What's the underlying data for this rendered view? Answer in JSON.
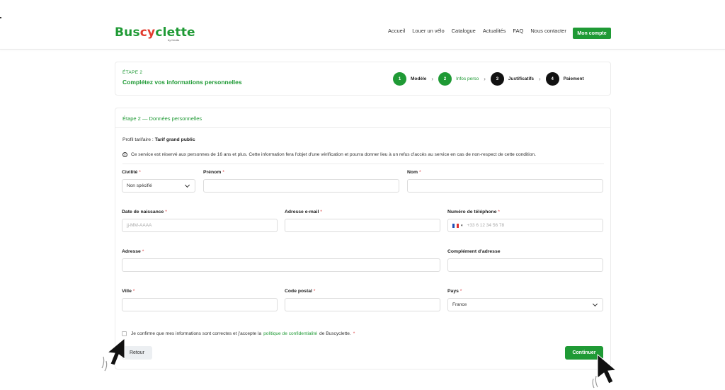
{
  "header": {
    "logo_part1": "Bus",
    "logo_part2": "cy",
    "logo_part3": "clette",
    "logo_sub": "by Keolis",
    "nav": [
      "Accueil",
      "Louer un vélo",
      "Catalogue",
      "Actualités",
      "FAQ",
      "Nous contacter"
    ],
    "account_button": "Mon compte"
  },
  "step_card": {
    "step_label": "ÉTAPE 2",
    "title": "Complétez vos informations personnelles",
    "steps": [
      {
        "num": "1",
        "name": "Modèle",
        "state": "done"
      },
      {
        "num": "2",
        "name": "Infos perso",
        "state": "current"
      },
      {
        "num": "3",
        "name": "Justificatifs",
        "state": "todo"
      },
      {
        "num": "4",
        "name": "Paiement",
        "state": "todo"
      }
    ],
    "separator": "›"
  },
  "form": {
    "title": "Étape 2 — Données personnelles",
    "profile_label": "Profil tarifaire : ",
    "profile_value": "Tarif grand public",
    "notice": "Ce service est réservé aux personnes de 16 ans et plus. Cette information fera l'objet d'une vérification et pourra donner lieu à un refus d'accès au service en cas de non-respect de cette condition.",
    "required_mark": "*",
    "fields": {
      "civility": {
        "label": "Civilité",
        "value": "Non spécifié"
      },
      "firstname": {
        "label": "Prénom",
        "value": ""
      },
      "lastname": {
        "label": "Nom",
        "value": ""
      },
      "birthdate": {
        "label": "Date de naissance",
        "placeholder": "jj-MM-AAAA"
      },
      "email": {
        "label": "Adresse e-mail",
        "value": ""
      },
      "phone": {
        "label": "Numéro de téléphone",
        "placeholder": "+33 6 12 34 56 78"
      },
      "address": {
        "label": "Adresse",
        "value": ""
      },
      "address2": {
        "label": "Complément d'adresse",
        "value": ""
      },
      "city": {
        "label": "Ville",
        "value": ""
      },
      "postcode": {
        "label": "Code postal",
        "value": ""
      },
      "country": {
        "label": "Pays",
        "value": "France"
      }
    },
    "consent_before": "Je confirme que mes informations sont correctes et j'accepte la",
    "consent_link": "politique de confidentialité",
    "consent_after": "de Buscyclette.",
    "back_button": "Retour",
    "continue_button": "Continuer"
  },
  "colors": {
    "accent": "#1f9a35",
    "required": "#d9373b",
    "dark_step": "#111111"
  }
}
